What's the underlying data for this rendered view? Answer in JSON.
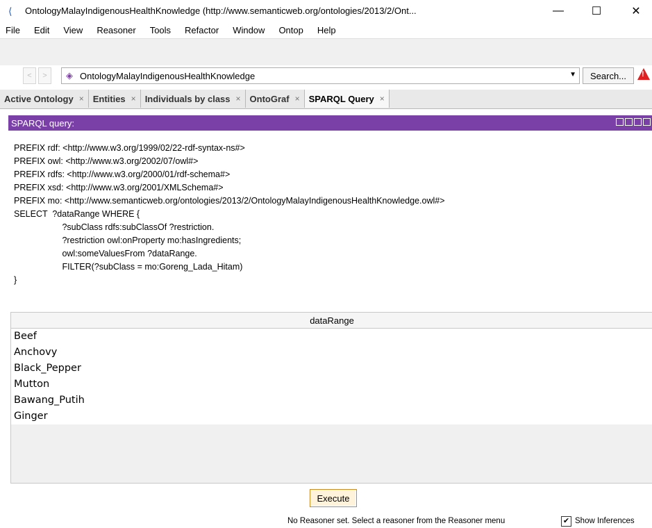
{
  "window": {
    "title": "OntologyMalayIndigenousHealthKnowledge (http://www.semanticweb.org/ontologies/2013/2/Ont...",
    "minimize": "—",
    "maximize": "☐",
    "close": "✕"
  },
  "menu": [
    "File",
    "Edit",
    "View",
    "Reasoner",
    "Tools",
    "Refactor",
    "Window",
    "Ontop",
    "Help"
  ],
  "toolbar": {
    "back": "<",
    "forward": ">",
    "ontology": "OntologyMalayIndigenousHealthKnowledge",
    "search_label": "Search..."
  },
  "tabs": [
    {
      "label": "Active Ontology",
      "active": false
    },
    {
      "label": "Entities",
      "active": false
    },
    {
      "label": "Individuals by class",
      "active": false
    },
    {
      "label": "OntoGraf",
      "active": false
    },
    {
      "label": "SPARQL Query",
      "active": true
    }
  ],
  "view": {
    "header": "SPARQL query:"
  },
  "query_lines": [
    "PREFIX rdf: <http://www.w3.org/1999/02/22-rdf-syntax-ns#>",
    "PREFIX owl: <http://www.w3.org/2002/07/owl#>",
    "PREFIX rdfs: <http://www.w3.org/2000/01/rdf-schema#>",
    "PREFIX xsd: <http://www.w3.org/2001/XMLSchema#>",
    "PREFIX mo: <http://www.semanticweb.org/ontologies/2013/2/OntologyMalayIndigenousHealthKnowledge.owl#>",
    "SELECT  ?dataRange WHERE {",
    "                    ?subClass rdfs:subClassOf ?restriction.",
    "                    ?restriction owl:onProperty mo:hasIngredients;",
    "                    owl:someValuesFrom ?dataRange.",
    "                    FILTER(?subClass = mo:Goreng_Lada_Hitam)",
    "}"
  ],
  "results": {
    "column": "dataRange",
    "rows": [
      "Beef",
      "Anchovy",
      "Black_Pepper",
      "Mutton",
      "Bawang_Putih",
      "Ginger"
    ]
  },
  "execute_label": "Execute",
  "status": {
    "message": "No Reasoner set. Select a reasoner from the Reasoner menu",
    "show_inferences": "Show Inferences",
    "show_inferences_checked": true
  }
}
